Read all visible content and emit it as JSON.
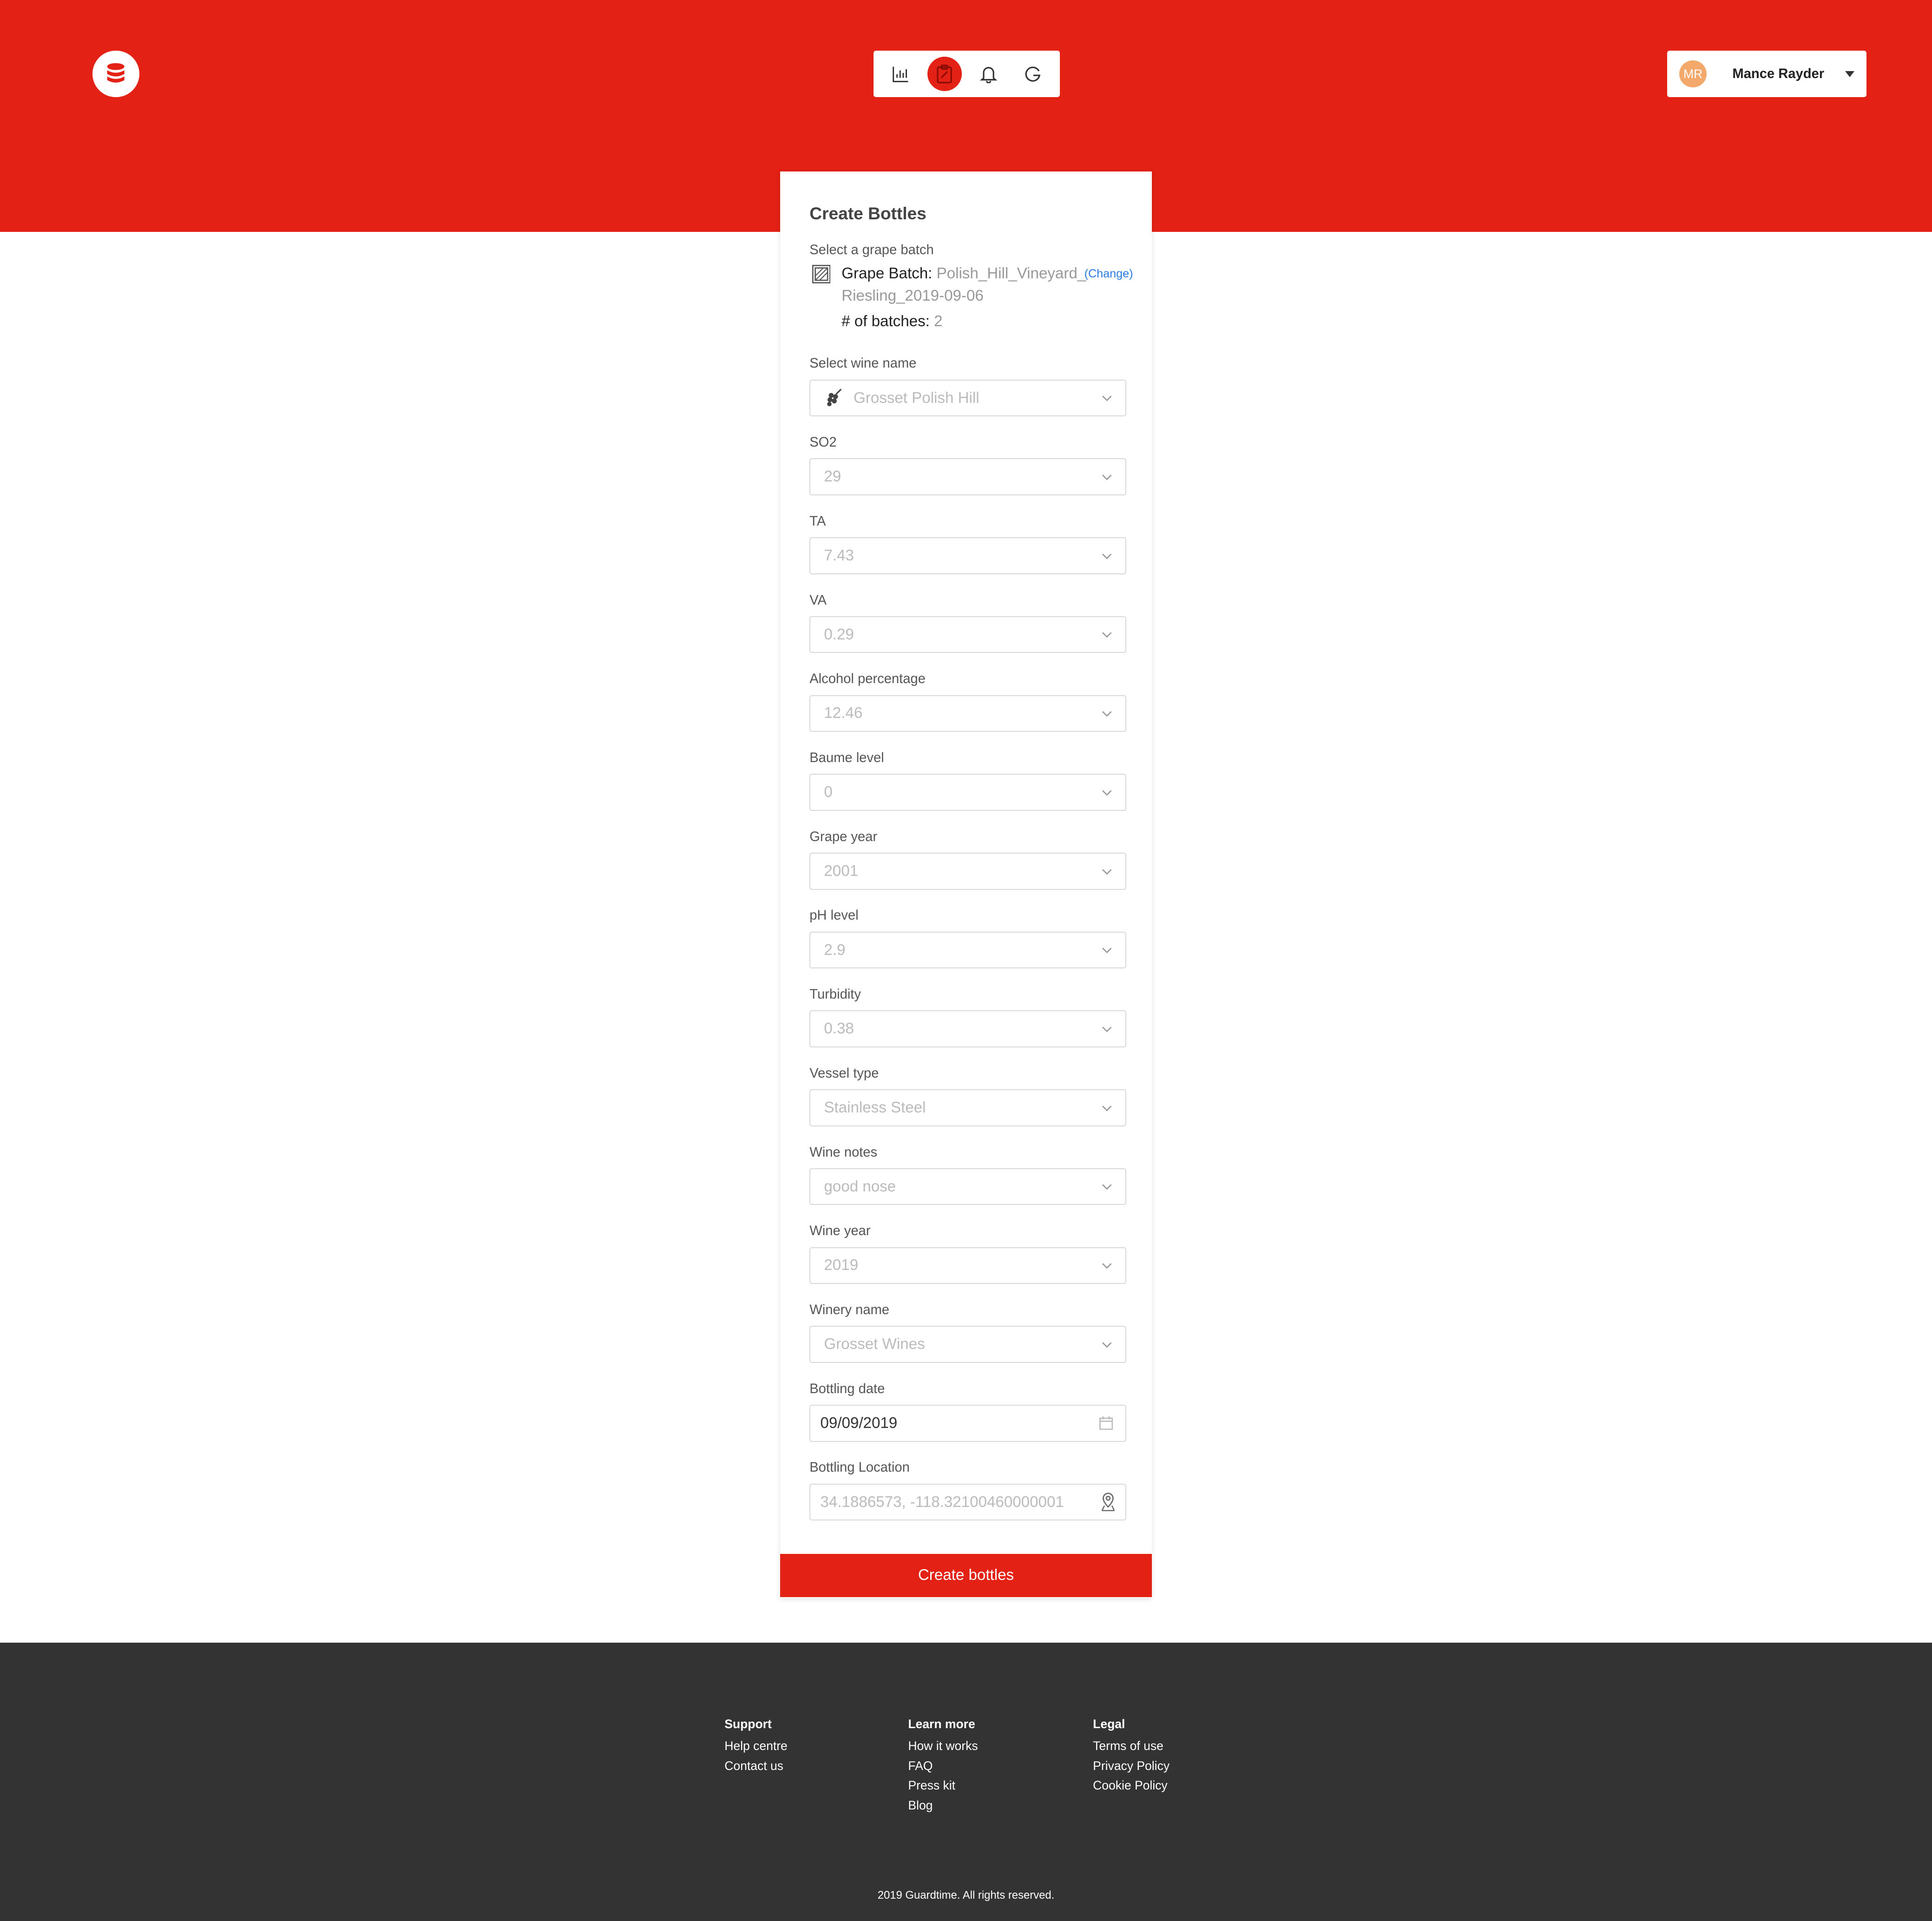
{
  "header": {
    "logo_icon": "wine-barrel-logo-icon",
    "nav_icons": [
      "chart-icon",
      "clipboard-icon",
      "bell-icon",
      "refresh-icon"
    ],
    "active_nav": "clipboard-icon",
    "user": {
      "initials": "MR",
      "name": "Mance Rayder"
    },
    "brand_color": "#e32114"
  },
  "form": {
    "title": "Create Bottles",
    "grape_batch_label": "Select a grape batch",
    "grape_batch_key": "Grape Batch:",
    "grape_batch_value_line1": "Polish_Hill_Vineyard_",
    "grape_batch_value_line2": "Riesling_2019-09-06",
    "change_link": "(Change)",
    "batches_key": "# of batches:",
    "batches_value": "2",
    "fields": [
      {
        "label": "Select wine name",
        "value": "Grosset Polish Hill"
      },
      {
        "label": "SO2",
        "value": "29"
      },
      {
        "label": "TA",
        "value": "7.43"
      },
      {
        "label": "VA",
        "value": "0.29"
      },
      {
        "label": "Alcohol percentage",
        "value": "12.46"
      },
      {
        "label": "Baume level",
        "value": "0"
      },
      {
        "label": "Grape year",
        "value": "2001"
      },
      {
        "label": "pH level",
        "value": "2.9"
      },
      {
        "label": "Turbidity",
        "value": "0.38"
      },
      {
        "label": "Vessel type",
        "value": "Stainless Steel"
      },
      {
        "label": "Wine notes",
        "value": "good nose"
      },
      {
        "label": "Wine year",
        "value": "2019"
      },
      {
        "label": "Winery name",
        "value": "Grosset Wines"
      },
      {
        "label": "Bottling date",
        "value": "09/09/2019"
      },
      {
        "label": "Bottling Location",
        "value": "34.1886573, -118.32100460000001"
      }
    ],
    "submit_label": "Create bottles"
  },
  "footer": {
    "support": {
      "heading": "Support",
      "links": [
        "Help centre",
        "Contact us"
      ]
    },
    "learn": {
      "heading": "Learn more",
      "links": [
        "How it works",
        "FAQ",
        "Press kit",
        "Blog"
      ]
    },
    "legal": {
      "heading": "Legal",
      "links": [
        "Terms of use",
        "Privacy Policy",
        "Cookie Policy"
      ]
    },
    "copyright": "2019 Guardtime. All rights reserved."
  }
}
